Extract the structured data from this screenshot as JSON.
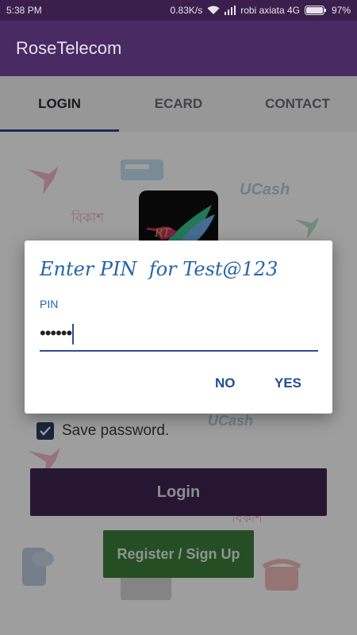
{
  "status_bar": {
    "time": "5:38 PM",
    "speed": "0.83K/s",
    "carrier": "robi axiata 4G",
    "battery": "97%"
  },
  "app_bar": {
    "title": "RoseTelecom"
  },
  "tabs": [
    {
      "label": "LOGIN",
      "active": true
    },
    {
      "label": "ECARD",
      "active": false
    },
    {
      "label": "CONTACT",
      "active": false
    }
  ],
  "background_brands": [
    "UCash",
    "বিকাশ"
  ],
  "form": {
    "save_password_label": "Save password.",
    "save_password_checked": true,
    "login_label": "Login",
    "register_label": "Register / Sign Up"
  },
  "dialog": {
    "title": "Enter PIN  for Test@123",
    "pin_label": "PIN",
    "pin_value": "••••••",
    "no_label": "NO",
    "yes_label": "YES"
  },
  "colors": {
    "app_bar": "#4a2a62",
    "accent_blue": "#2563a8",
    "login_button": "#3f2450",
    "register_button": "#3c7f3c"
  }
}
